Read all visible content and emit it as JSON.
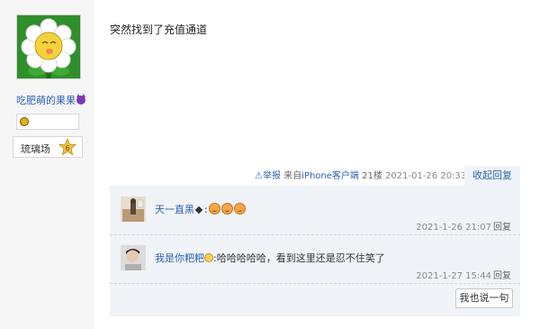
{
  "user": {
    "name": "吃肥萌的果果",
    "badge_label": "琉璃场",
    "badge_level": "6"
  },
  "post": {
    "content": "突然找到了充值通道",
    "report_label": "举报",
    "source": "来自",
    "device": "iPhone客户端",
    "floor": "21楼",
    "time": "2021-01-26 20:33",
    "collapse_label": "收起回复"
  },
  "replies": [
    {
      "user": "天一直黑",
      "text": "",
      "time": "2021-1-26 21:07",
      "reply_label": "回复"
    },
    {
      "user": "我是你粑粑",
      "text": ":哈哈哈哈哈，看到这里还是忍不住笑了",
      "time": "2021-1-27 15:44",
      "reply_label": "回复"
    }
  ],
  "say_button": "我也说一句",
  "colors": {
    "link_blue": "#2d64b3",
    "reply_bg": "#f0f3f7",
    "sidebar_bg": "#f6f6f6",
    "avatar_green": "#2f8f2a"
  },
  "icons": [
    "flower-avatar-icon",
    "devil-icon",
    "level-icon",
    "star-badge-icon",
    "warning-icon",
    "emoji-face-icon",
    "diamond-icon"
  ]
}
